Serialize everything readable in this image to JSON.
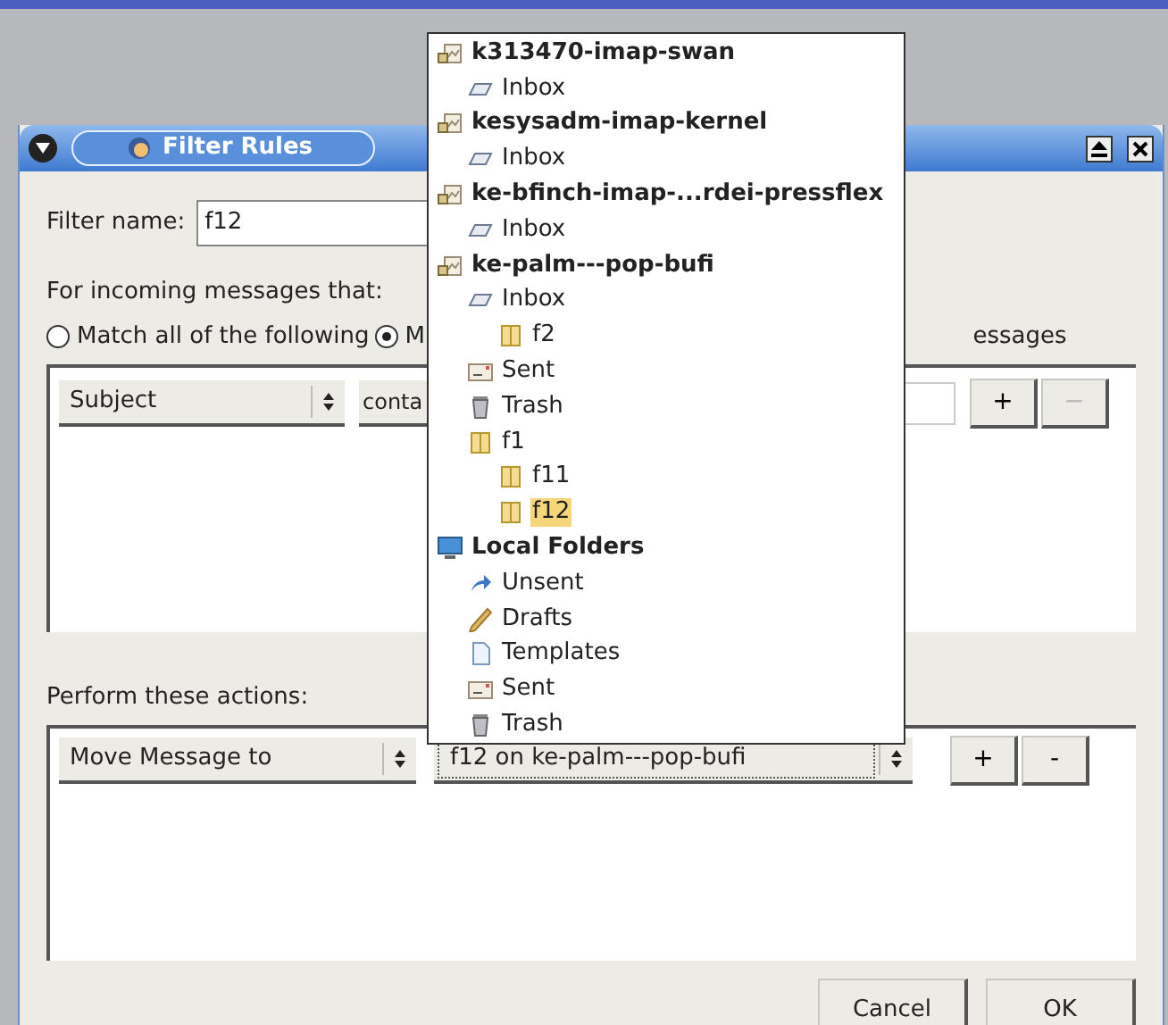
{
  "window": {
    "title": "Filter Rules"
  },
  "filter_name": {
    "label": "Filter name:",
    "value": "f12"
  },
  "incoming": {
    "label": "For incoming messages that:",
    "options": [
      {
        "label": "Match all of the following",
        "selected": false
      },
      {
        "label": "M",
        "selected": true
      }
    ],
    "trailing_text": "essages"
  },
  "criteria": [
    {
      "field": "Subject",
      "operator": "conta",
      "buttons": [
        {
          "label": "+",
          "disabled": false
        },
        {
          "label": "−",
          "disabled": true
        }
      ]
    }
  ],
  "actions": {
    "label": "Perform these actions:",
    "rows": [
      {
        "action": "Move Message to",
        "target": "f12 on ke-palm---pop-bufi",
        "buttons": [
          {
            "label": "+",
            "disabled": false
          },
          {
            "label": "-",
            "disabled": false
          }
        ]
      }
    ]
  },
  "footer_buttons": [
    "Cancel",
    "OK"
  ],
  "folder_menu": {
    "items": [
      {
        "kind": "account",
        "label": "k313470-imap-swan",
        "selected": false,
        "children": [
          {
            "kind": "inbox",
            "label": "Inbox",
            "selected": false
          }
        ]
      },
      {
        "kind": "account",
        "label": "kesysadm-imap-kernel",
        "selected": false,
        "children": [
          {
            "kind": "inbox",
            "label": "Inbox",
            "selected": false
          }
        ]
      },
      {
        "kind": "account",
        "label": "ke-bfinch-imap-...rdei-pressflex",
        "selected": false,
        "children": [
          {
            "kind": "inbox",
            "label": "Inbox",
            "selected": false
          }
        ]
      },
      {
        "kind": "account",
        "label": "ke-palm---pop-bufi",
        "selected": false,
        "children": [
          {
            "kind": "inbox",
            "label": "Inbox",
            "selected": false,
            "children": [
              {
                "kind": "folder",
                "label": "f2",
                "selected": false
              }
            ]
          },
          {
            "kind": "sent",
            "label": "Sent",
            "selected": false
          },
          {
            "kind": "trash",
            "label": "Trash",
            "selected": false
          },
          {
            "kind": "folder",
            "label": "f1",
            "selected": false,
            "children": [
              {
                "kind": "folder",
                "label": "f11",
                "selected": false
              },
              {
                "kind": "folder",
                "label": "f12",
                "selected": true
              }
            ]
          }
        ]
      },
      {
        "kind": "local",
        "label": "Local Folders",
        "selected": false,
        "children": [
          {
            "kind": "unsent",
            "label": "Unsent",
            "selected": false
          },
          {
            "kind": "drafts",
            "label": "Drafts",
            "selected": false
          },
          {
            "kind": "templates",
            "label": "Templates",
            "selected": false
          },
          {
            "kind": "sent",
            "label": "Sent",
            "selected": false
          },
          {
            "kind": "trash",
            "label": "Trash",
            "selected": false
          }
        ]
      }
    ]
  }
}
